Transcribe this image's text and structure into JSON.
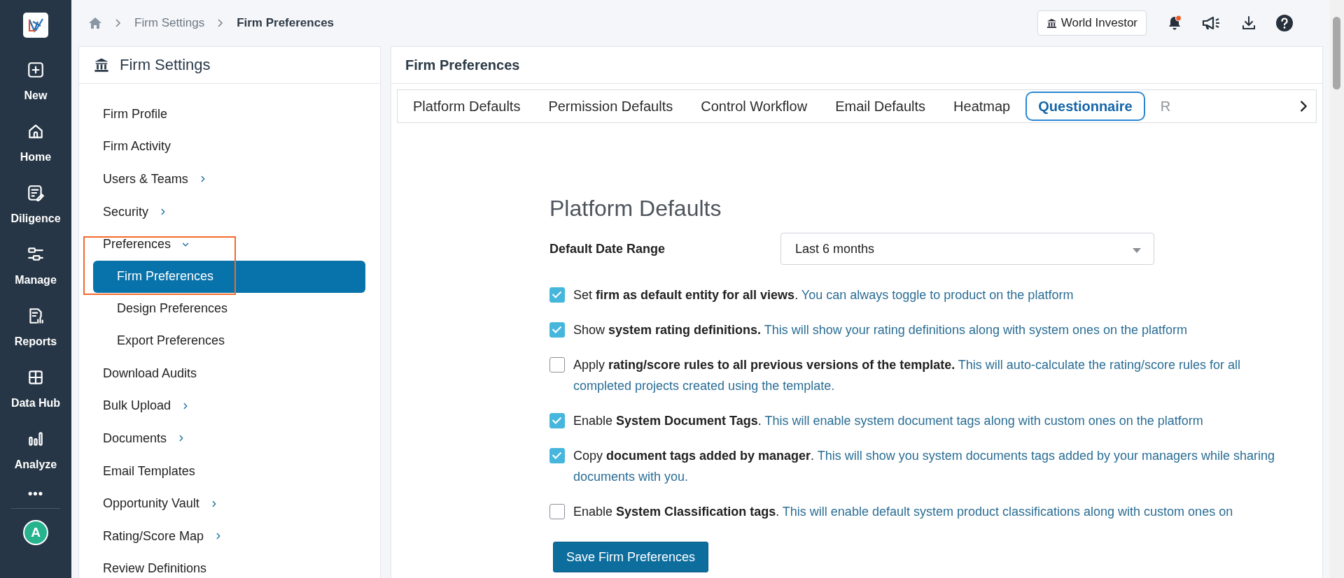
{
  "rail": {
    "items": [
      {
        "label": "New"
      },
      {
        "label": "Home"
      },
      {
        "label": "Diligence"
      },
      {
        "label": "Manage"
      },
      {
        "label": "Reports"
      },
      {
        "label": "Data Hub"
      },
      {
        "label": "Analyze"
      }
    ],
    "more": "•••",
    "avatar": "A"
  },
  "breadcrumb": [
    "Firm Settings",
    "Firm Preferences"
  ],
  "topbar": {
    "firm_button": "World Investor"
  },
  "sidebar": {
    "title": "Firm Settings",
    "items": [
      {
        "label": "Firm Profile",
        "kind": "link"
      },
      {
        "label": "Firm Activity",
        "kind": "link"
      },
      {
        "label": "Users & Teams",
        "kind": "group",
        "expanded": false
      },
      {
        "label": "Security",
        "kind": "group",
        "expanded": false
      },
      {
        "label": "Preferences",
        "kind": "group",
        "expanded": true,
        "highlighted": true,
        "children": [
          {
            "label": "Firm Preferences",
            "selected": true
          },
          {
            "label": "Design Preferences",
            "selected": false
          },
          {
            "label": "Export Preferences",
            "selected": false
          }
        ]
      },
      {
        "label": "Download Audits",
        "kind": "link"
      },
      {
        "label": "Bulk Upload",
        "kind": "group",
        "expanded": false
      },
      {
        "label": "Documents",
        "kind": "group",
        "expanded": false
      },
      {
        "label": "Email Templates",
        "kind": "link"
      },
      {
        "label": "Opportunity Vault",
        "kind": "group",
        "expanded": false
      },
      {
        "label": "Rating/Score Map",
        "kind": "group",
        "expanded": false
      },
      {
        "label": "Review Definitions",
        "kind": "link"
      }
    ]
  },
  "panel": {
    "title": "Firm Preferences",
    "tabs": [
      {
        "label": "Platform Defaults",
        "selected": false
      },
      {
        "label": "Permission Defaults",
        "selected": false
      },
      {
        "label": "Control Workflow",
        "selected": false
      },
      {
        "label": "Email Defaults",
        "selected": false
      },
      {
        "label": "Heatmap",
        "selected": false
      },
      {
        "label": "Questionnaire",
        "selected": true
      },
      {
        "label": "R",
        "selected": false
      }
    ],
    "section": {
      "heading": "Platform Defaults",
      "date_range": {
        "label": "Default Date Range",
        "value": "Last 6 months"
      },
      "options": [
        {
          "text": "Set **firm as default entity for all views**.",
          "description": "You can always toggle to product on the platform",
          "checked": true
        },
        {
          "text": "Show **system rating definitions.**",
          "description": "This will show your rating definitions along with system ones on the platform",
          "checked": true
        },
        {
          "text": "Apply **rating/score rules to all previous versions of the template.**",
          "description": "This will auto-calculate the rating/score rules for all completed projects created using the template.",
          "checked": false
        },
        {
          "text": "Enable **System Document Tags**.",
          "description": "This will enable system document tags along with custom ones on the platform",
          "checked": true
        },
        {
          "text": "Copy **document tags added by manager**.",
          "description": "This will show you system documents tags added by your managers while sharing documents with you.",
          "checked": true
        },
        {
          "text": "Enable **System Classification tags**.",
          "description": "This will enable default system product classifications along with custom ones on",
          "checked": false
        }
      ]
    },
    "save_button": "Save Firm Preferences"
  }
}
